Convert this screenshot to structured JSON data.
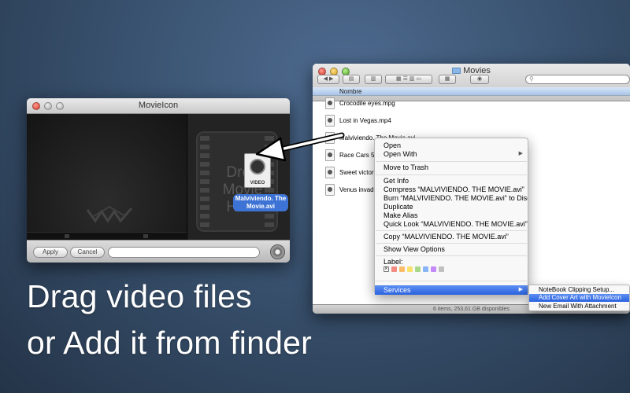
{
  "movieicon_window": {
    "title": "MovieIcon",
    "drop_hint": "Drop Movie Here",
    "dragged_icon_label": "VIDEO",
    "dragged_file": "Malviviendo. The Movie.avi",
    "apply_label": "Apply",
    "cancel_label": "Cancel",
    "path_value": ""
  },
  "finder": {
    "title": "Movies",
    "column_header": "Nombre",
    "files": [
      "Crocodile eyes.mpg",
      "Lost in Vegas.mp4",
      "Malviviendo. The Movie.avi",
      "Race Cars 5.m",
      "Sweet victory",
      "Venus invade"
    ],
    "status": "6 items, 253,61 GB disponibles"
  },
  "context_menu": {
    "items": [
      "Open",
      "Open With",
      "Move to Trash",
      "Get Info",
      "Compress “MALVIVIENDO. THE MOVIE.avi”",
      "Burn “MALVIVIENDO. THE MOVIE.avi” to Disc...",
      "Duplicate",
      "Make Alias",
      "Quick Look “MALVIVIENDO. THE MOVIE.avi”",
      "Copy “MALVIVIENDO. THE MOVIE.avi”",
      "Show View Options",
      "Label:",
      "Services"
    ],
    "label_colors": [
      "#f28b82",
      "#fbbc6a",
      "#f7e26b",
      "#a8d88a",
      "#8ab4f8",
      "#c58af9",
      "#c0c0c0"
    ]
  },
  "services_submenu": {
    "items": [
      "NoteBook Clipping Setup...",
      "Add Cover Art with MovieIcon",
      "New Email With Attachment"
    ]
  },
  "tagline": {
    "line1": "Drag video files",
    "line2": "or Add it from finder"
  }
}
